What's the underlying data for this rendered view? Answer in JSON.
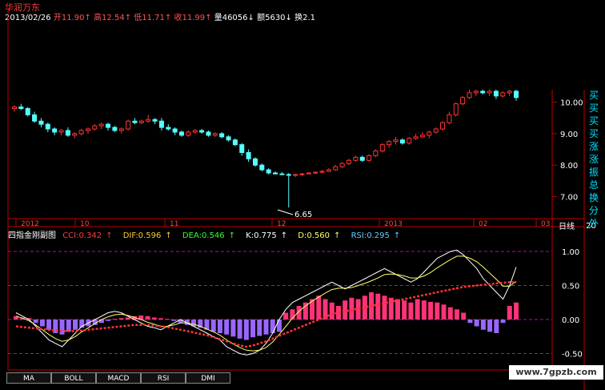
{
  "header": {
    "stock_name": "华润万东",
    "date": "2013/02/26",
    "open_label": "开",
    "open_value": "11.90",
    "open_arrow": "↑",
    "high_label": "高",
    "high_value": "12.54",
    "high_arrow": "↑",
    "low_label": "低",
    "low_value": "11.71",
    "low_arrow": "↑",
    "close_label": "收",
    "close_value": "11.99",
    "close_arrow": "↑",
    "volume_label": "量",
    "volume_value": "46056",
    "volume_arrow": "↓",
    "amount_label": "额",
    "amount_value": "5630",
    "amount_arrow": "↓",
    "turnover_label": "换",
    "turnover_value": "2.1"
  },
  "price_axis": {
    "ticks": [
      "10.00",
      "9.00",
      "8.00",
      "7.00"
    ],
    "low_marker": "6.65"
  },
  "time_axis": {
    "labels": [
      "2012",
      "10",
      "11",
      "12",
      "2013",
      "02",
      "03"
    ],
    "period": "日线",
    "right_value": "20"
  },
  "indicator": {
    "name": "四指金刚副图",
    "cci": "CCI:0.342",
    "cci_arrow": "↑",
    "dif": "DIF:0.596",
    "dif_arrow": "↑",
    "dea": "DEA:0.546",
    "dea_arrow": "↑",
    "k": "K:0.775",
    "k_arrow": "↑",
    "d": "D:0.560",
    "d_arrow": "↑",
    "rsi": "RSI:0.295",
    "rsi_arrow": "↑",
    "ticks": [
      "1.00",
      "0.50",
      "0.00",
      "-0.50"
    ]
  },
  "tabs": [
    "MA",
    "BOLL",
    "MACD",
    "RSI",
    "DMI"
  ],
  "side_signals": [
    "买",
    "买",
    "买",
    "买",
    "涨",
    "涨",
    "振",
    "总",
    "换",
    "分",
    "外"
  ],
  "watermark": "www.7gpzb.com",
  "colors": {
    "up": "#ff3333",
    "down": "#55ffff",
    "axis": "#c00000",
    "dash": "#c000c0"
  },
  "chart_data": {
    "type": "candlestick",
    "x_labels": [
      "2012",
      "10",
      "11",
      "12",
      "2013",
      "02",
      "03"
    ],
    "price_ticks": [
      10.0,
      9.0,
      8.0,
      7.0
    ],
    "price_range": [
      6.5,
      10.4
    ],
    "indicator_ticks": [
      1.0,
      0.5,
      0.0,
      -0.5
    ],
    "indicator_range": [
      -0.6,
      1.2
    ],
    "candles": [
      [
        9.8,
        9.9,
        9.7,
        9.85
      ],
      [
        9.85,
        9.95,
        9.75,
        9.8
      ],
      [
        9.8,
        9.85,
        9.55,
        9.6
      ],
      [
        9.6,
        9.7,
        9.35,
        9.4
      ],
      [
        9.4,
        9.5,
        9.2,
        9.3
      ],
      [
        9.3,
        9.35,
        9.05,
        9.15
      ],
      [
        9.15,
        9.2,
        8.95,
        9.05
      ],
      [
        9.05,
        9.15,
        8.95,
        9.1
      ],
      [
        9.1,
        9.2,
        8.9,
        8.95
      ],
      [
        8.95,
        9.05,
        8.85,
        9.0
      ],
      [
        9.0,
        9.15,
        8.95,
        9.1
      ],
      [
        9.1,
        9.2,
        9.0,
        9.15
      ],
      [
        9.15,
        9.3,
        9.1,
        9.25
      ],
      [
        9.25,
        9.35,
        9.15,
        9.3
      ],
      [
        9.3,
        9.35,
        9.1,
        9.2
      ],
      [
        9.2,
        9.25,
        9.05,
        9.1
      ],
      [
        9.1,
        9.2,
        9.0,
        9.15
      ],
      [
        9.15,
        9.45,
        9.1,
        9.4
      ],
      [
        9.4,
        9.5,
        9.3,
        9.35
      ],
      [
        9.35,
        9.45,
        9.3,
        9.4
      ],
      [
        9.4,
        9.6,
        9.35,
        9.45
      ],
      [
        9.45,
        9.5,
        9.3,
        9.4
      ],
      [
        9.4,
        9.5,
        9.1,
        9.2
      ],
      [
        9.2,
        9.3,
        9.1,
        9.15
      ],
      [
        9.15,
        9.2,
        8.95,
        9.05
      ],
      [
        9.05,
        9.1,
        8.9,
        8.95
      ],
      [
        8.95,
        9.1,
        8.9,
        9.05
      ],
      [
        9.05,
        9.15,
        9.0,
        9.1
      ],
      [
        9.1,
        9.15,
        9.0,
        9.05
      ],
      [
        9.05,
        9.1,
        8.9,
        8.95
      ],
      [
        8.95,
        9.05,
        8.9,
        9.0
      ],
      [
        9.0,
        9.05,
        8.85,
        8.9
      ],
      [
        8.9,
        8.95,
        8.75,
        8.8
      ],
      [
        8.8,
        8.85,
        8.6,
        8.65
      ],
      [
        8.65,
        8.7,
        8.3,
        8.4
      ],
      [
        8.4,
        8.5,
        8.1,
        8.2
      ],
      [
        8.2,
        8.25,
        7.95,
        8.0
      ],
      [
        8.0,
        8.05,
        7.8,
        7.85
      ],
      [
        7.85,
        7.9,
        7.7,
        7.75
      ],
      [
        7.75,
        7.8,
        7.7,
        7.72
      ],
      [
        7.72,
        7.78,
        7.68,
        7.7
      ],
      [
        7.7,
        7.75,
        6.65,
        7.68
      ],
      [
        7.68,
        7.72,
        7.62,
        7.7
      ],
      [
        7.7,
        7.75,
        7.65,
        7.72
      ],
      [
        7.72,
        7.78,
        7.7,
        7.75
      ],
      [
        7.75,
        7.8,
        7.72,
        7.77
      ],
      [
        7.77,
        7.85,
        7.75,
        7.8
      ],
      [
        7.8,
        7.9,
        7.78,
        7.85
      ],
      [
        7.85,
        8.0,
        7.82,
        7.95
      ],
      [
        7.95,
        8.1,
        7.9,
        8.05
      ],
      [
        8.05,
        8.2,
        8.0,
        8.15
      ],
      [
        8.15,
        8.3,
        8.1,
        8.25
      ],
      [
        8.25,
        8.3,
        8.1,
        8.15
      ],
      [
        8.15,
        8.35,
        8.1,
        8.3
      ],
      [
        8.3,
        8.5,
        8.25,
        8.45
      ],
      [
        8.45,
        8.7,
        8.4,
        8.65
      ],
      [
        8.65,
        8.8,
        8.55,
        8.75
      ],
      [
        8.75,
        8.9,
        8.65,
        8.8
      ],
      [
        8.8,
        8.85,
        8.65,
        8.7
      ],
      [
        8.7,
        8.9,
        8.65,
        8.85
      ],
      [
        8.85,
        9.0,
        8.8,
        8.9
      ],
      [
        8.9,
        9.05,
        8.85,
        8.95
      ],
      [
        8.95,
        9.1,
        8.85,
        9.05
      ],
      [
        9.05,
        9.2,
        9.0,
        9.15
      ],
      [
        9.15,
        9.4,
        9.1,
        9.35
      ],
      [
        9.35,
        9.7,
        9.3,
        9.6
      ],
      [
        9.6,
        10.0,
        9.55,
        9.95
      ],
      [
        9.95,
        10.2,
        9.9,
        10.15
      ],
      [
        10.15,
        10.4,
        10.1,
        10.3
      ],
      [
        10.3,
        10.4,
        10.2,
        10.35
      ],
      [
        10.35,
        10.4,
        10.25,
        10.3
      ],
      [
        10.3,
        10.4,
        10.2,
        10.35
      ],
      [
        10.35,
        10.4,
        10.1,
        10.2
      ],
      [
        10.2,
        10.35,
        10.15,
        10.3
      ],
      [
        10.3,
        10.4,
        10.2,
        10.35
      ],
      [
        10.35,
        10.4,
        10.05,
        10.15
      ]
    ],
    "histogram": [
      0.05,
      0.03,
      0.02,
      -0.05,
      -0.1,
      -0.15,
      -0.2,
      -0.22,
      -0.18,
      -0.15,
      -0.12,
      -0.1,
      -0.08,
      -0.05,
      -0.02,
      0.01,
      0.02,
      0.03,
      0.05,
      0.06,
      0.05,
      0.03,
      0.02,
      0.01,
      -0.02,
      -0.05,
      -0.08,
      -0.1,
      -0.12,
      -0.15,
      -0.18,
      -0.2,
      -0.22,
      -0.25,
      -0.28,
      -0.3,
      -0.26,
      -0.24,
      -0.22,
      -0.2,
      -0.18,
      0.1,
      0.15,
      0.2,
      0.25,
      0.3,
      0.35,
      0.3,
      0.25,
      0.2,
      0.28,
      0.32,
      0.3,
      0.35,
      0.4,
      0.38,
      0.35,
      0.32,
      0.3,
      0.28,
      0.25,
      0.3,
      0.28,
      0.26,
      0.25,
      0.22,
      0.18,
      0.15,
      0.1,
      -0.05,
      -0.1,
      -0.15,
      -0.18,
      -0.2,
      -0.05,
      0.2,
      0.25
    ],
    "series": {
      "k": [
        0.1,
        0.05,
        0.0,
        -0.1,
        -0.2,
        -0.3,
        -0.35,
        -0.4,
        -0.3,
        -0.2,
        -0.1,
        -0.05,
        0.0,
        0.05,
        0.1,
        0.12,
        0.1,
        0.05,
        0.0,
        -0.05,
        -0.1,
        -0.12,
        -0.15,
        -0.1,
        -0.05,
        0.0,
        -0.05,
        -0.1,
        -0.15,
        -0.2,
        -0.25,
        -0.3,
        -0.4,
        -0.45,
        -0.5,
        -0.52,
        -0.5,
        -0.45,
        -0.35,
        -0.2,
        0.0,
        0.15,
        0.25,
        0.3,
        0.35,
        0.4,
        0.45,
        0.5,
        0.55,
        0.5,
        0.45,
        0.5,
        0.55,
        0.6,
        0.65,
        0.7,
        0.75,
        0.7,
        0.65,
        0.6,
        0.55,
        0.6,
        0.7,
        0.8,
        0.9,
        0.95,
        1.0,
        1.02,
        0.95,
        0.85,
        0.75,
        0.6,
        0.5,
        0.4,
        0.3,
        0.5,
        0.77
      ],
      "d": [
        0.05,
        0.02,
        -0.02,
        -0.08,
        -0.15,
        -0.22,
        -0.28,
        -0.32,
        -0.3,
        -0.25,
        -0.18,
        -0.12,
        -0.06,
        0.0,
        0.04,
        0.07,
        0.08,
        0.06,
        0.03,
        0.0,
        -0.04,
        -0.07,
        -0.1,
        -0.1,
        -0.08,
        -0.05,
        -0.05,
        -0.07,
        -0.1,
        -0.14,
        -0.18,
        -0.23,
        -0.3,
        -0.36,
        -0.41,
        -0.45,
        -0.46,
        -0.45,
        -0.41,
        -0.33,
        -0.22,
        -0.1,
        0.02,
        0.12,
        0.2,
        0.27,
        0.33,
        0.39,
        0.44,
        0.46,
        0.46,
        0.47,
        0.5,
        0.53,
        0.57,
        0.61,
        0.66,
        0.67,
        0.66,
        0.64,
        0.61,
        0.61,
        0.64,
        0.69,
        0.76,
        0.82,
        0.88,
        0.93,
        0.93,
        0.9,
        0.85,
        0.77,
        0.68,
        0.59,
        0.49,
        0.49,
        0.56
      ],
      "dea": [
        -0.1,
        -0.11,
        -0.12,
        -0.13,
        -0.14,
        -0.15,
        -0.16,
        -0.17,
        -0.17,
        -0.17,
        -0.16,
        -0.15,
        -0.14,
        -0.13,
        -0.12,
        -0.11,
        -0.1,
        -0.09,
        -0.08,
        -0.08,
        -0.08,
        -0.09,
        -0.1,
        -0.11,
        -0.13,
        -0.15,
        -0.17,
        -0.19,
        -0.21,
        -0.23,
        -0.26,
        -0.29,
        -0.32,
        -0.35,
        -0.38,
        -0.4,
        -0.38,
        -0.35,
        -0.32,
        -0.28,
        -0.24,
        -0.2,
        -0.16,
        -0.12,
        -0.08,
        -0.04,
        0.0,
        0.04,
        0.08,
        0.1,
        0.12,
        0.14,
        0.16,
        0.18,
        0.2,
        0.22,
        0.24,
        0.26,
        0.28,
        0.3,
        0.32,
        0.34,
        0.36,
        0.38,
        0.4,
        0.42,
        0.44,
        0.46,
        0.48,
        0.49,
        0.5,
        0.51,
        0.52,
        0.53,
        0.54,
        0.55,
        0.546
      ]
    }
  }
}
